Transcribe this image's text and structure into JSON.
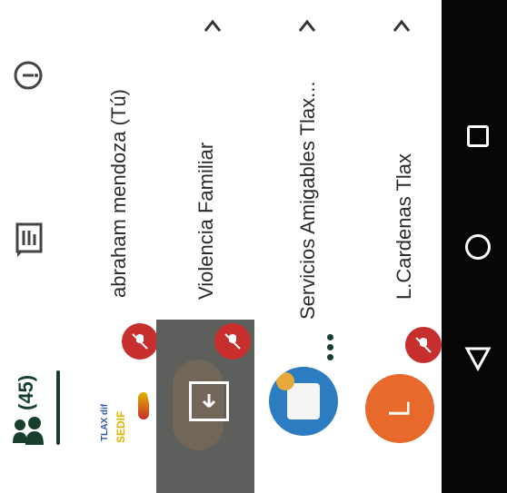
{
  "participants_tab": {
    "count": "(45)",
    "icon": "people-icon"
  },
  "toolbar": {
    "chat_icon": "chat-icon",
    "info_icon": "info-icon"
  },
  "participants": [
    {
      "name": "abraham mendoza (Tú)",
      "avatar_text": "",
      "muted": true
    },
    {
      "name": "Violencia Familiar",
      "muted": true
    },
    {
      "name": "Servicios Amigables Tlax...",
      "muted": false
    },
    {
      "name": "L.Cardenas Tlax",
      "avatar_letter": "L",
      "muted": true
    }
  ],
  "logos": {
    "sedif": "SEDIF",
    "tlax": "TLAX dif"
  },
  "colors": {
    "accent_green": "#173f2e",
    "mute_red": "#c72e2e",
    "avatar_orange": "#e7692b",
    "dark_tile": "#5c5f5b",
    "navbar": "#060606"
  }
}
